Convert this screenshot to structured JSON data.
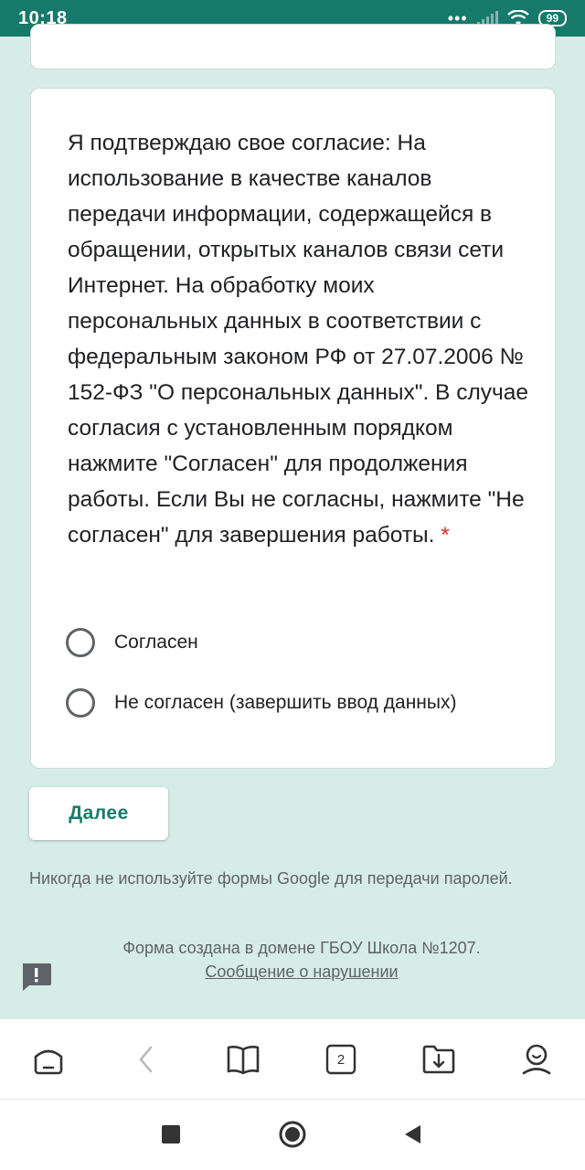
{
  "status_bar": {
    "time": "10:18",
    "dots": "•••",
    "battery": "99"
  },
  "question": {
    "text": "Я подтверждаю свое согласие: На использование в качестве каналов передачи информации, содержащейся в обращении, открытых каналов связи сети Интернет. На обработку моих персональных данных в соответствии с федеральным законом РФ от 27.07.2006 № 152-ФЗ \"О персональных данных\". В случае согласия с установленным порядком нажмите \"Согласен\" для продолжения работы. Если Вы не согласны, нажмите \"Не согласен\" для завершения работы.",
    "required_mark": "*",
    "options": [
      {
        "label": "Согласен",
        "selected": false
      },
      {
        "label": "Не согласен (завершить ввод данных)",
        "selected": false
      }
    ]
  },
  "next_button": {
    "label": "Далее"
  },
  "warning": "Никогда не используйте формы Google для передачи паролей.",
  "footer": {
    "created_text": "Форма создана в домене ГБОУ Школа №1207.",
    "report_link": "Сообщение о нарушении"
  },
  "browser_toolbar": {
    "tab_count": "2"
  },
  "colors": {
    "status_bar": "#167a6a",
    "page_background": "#d6ece7",
    "accent": "#1a7a69",
    "required": "#d93025"
  }
}
